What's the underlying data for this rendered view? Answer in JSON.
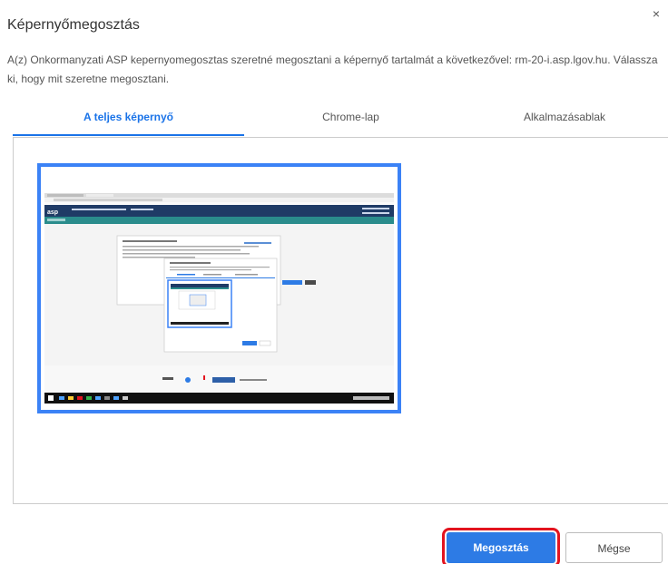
{
  "dialog": {
    "title": "Képernyőmegosztás",
    "description": "A(z) Onkormanyzati ASP kepernyomegosztas szeretné megosztani a képernyő tartalmát a következővel: rm-20-i.asp.lgov.hu. Válassza ki, hogy mit szeretne megosztani.",
    "close_icon": "close-icon"
  },
  "tabs": [
    {
      "label": "A teljes képernyő",
      "active": true
    },
    {
      "label": "Chrome-lap",
      "active": false
    },
    {
      "label": "Alkalmazásablak",
      "active": false
    }
  ],
  "preview": {
    "kind": "screen-thumbnail",
    "selected": true,
    "thumbnail_text": "asp"
  },
  "buttons": {
    "share_label": "Megosztás",
    "cancel_label": "Mégse"
  },
  "colors": {
    "accent": "#1a73e8",
    "share_button": "#2d7be5",
    "highlight": "#e3141f"
  }
}
